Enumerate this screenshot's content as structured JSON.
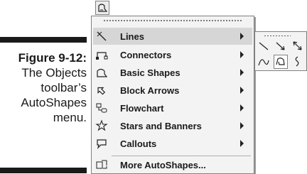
{
  "caption": {
    "figure_number": "Figure 9-12:",
    "lines": [
      "The Objects",
      "toolbar’s",
      "AutoShapes",
      "menu."
    ]
  },
  "toolbar": {
    "autoshapes_button_icon": "autoshapes-icon"
  },
  "menu": {
    "items": [
      {
        "label": "Lines",
        "icon": "line-icon",
        "has_submenu": true,
        "highlighted": true
      },
      {
        "label": "Connectors",
        "icon": "connector-icon",
        "has_submenu": true
      },
      {
        "label": "Basic Shapes",
        "icon": "basic-shapes-icon",
        "has_submenu": true
      },
      {
        "label": "Block Arrows",
        "icon": "block-arrow-icon",
        "has_submenu": true
      },
      {
        "label": "Flowchart",
        "icon": "flowchart-icon",
        "has_submenu": true
      },
      {
        "label": "Stars and Banners",
        "icon": "star-icon",
        "has_submenu": true
      },
      {
        "label": "Callouts",
        "icon": "callout-icon",
        "has_submenu": true
      },
      {
        "label": "More AutoShapes...",
        "icon": "more-autoshapes-icon",
        "has_submenu": false
      }
    ]
  },
  "submenu": {
    "buttons": [
      {
        "icon": "line-icon"
      },
      {
        "icon": "arrow-icon"
      },
      {
        "icon": "double-arrow-icon"
      },
      {
        "icon": "curve-icon"
      },
      {
        "icon": "freeform-icon",
        "pressed": true
      },
      {
        "icon": "scribble-icon"
      }
    ]
  }
}
